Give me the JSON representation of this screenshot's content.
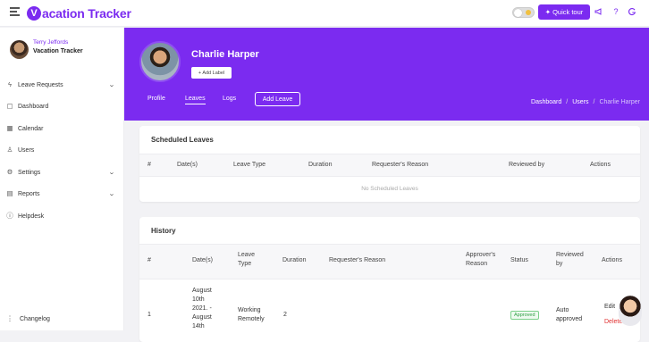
{
  "brand": {
    "logo_letter": "V",
    "name": "acation Tracker",
    "accent": "#7b2bf0"
  },
  "topbar": {
    "quick_tour_label": "✦ Quick tour",
    "icons": [
      "megaphone-icon",
      "help-icon",
      "g-icon"
    ]
  },
  "sidebar": {
    "user_name": "Terry Jeffords",
    "company": "Vacation Tracker",
    "items": [
      {
        "label": "Leave Requests",
        "icon": "lightning-icon",
        "expandable": true
      },
      {
        "label": "Dashboard",
        "icon": "dashboard-icon",
        "expandable": false
      },
      {
        "label": "Calendar",
        "icon": "calendar-icon",
        "expandable": false
      },
      {
        "label": "Users",
        "icon": "user-icon",
        "expandable": false
      },
      {
        "label": "Settings",
        "icon": "gear-icon",
        "expandable": true
      },
      {
        "label": "Reports",
        "icon": "reports-icon",
        "expandable": true
      },
      {
        "label": "Helpdesk",
        "icon": "help-circle-icon",
        "expandable": false
      }
    ],
    "changelog": "Changelog"
  },
  "profile": {
    "name": "Charlie Harper",
    "add_label": "+ Add Label",
    "tabs": [
      "Profile",
      "Leaves",
      "Logs"
    ],
    "active_tab": "Leaves",
    "add_leave": "Add Leave"
  },
  "breadcrumb": [
    "Dashboard",
    "Users",
    "Charlie Harper"
  ],
  "scheduled": {
    "title": "Scheduled Leaves",
    "columns": [
      "#",
      "Date(s)",
      "Leave Type",
      "Duration",
      "Requester's Reason",
      "Reviewed by",
      "Actions"
    ],
    "empty": "No Scheduled Leaves"
  },
  "history": {
    "title": "History",
    "columns": [
      "#",
      "Date(s)",
      "Leave\nType",
      "Duration",
      "Requester's Reason",
      "Approver's\nReason",
      "Status",
      "Reviewed\nby",
      "Actions"
    ],
    "rows": [
      {
        "index": "1",
        "dates": "August\n10th\n2021. -\nAugust\n14th",
        "leave_type": "Working\nRemotely",
        "duration": "2",
        "status": "Approved",
        "reviewed_by": "Auto\napproved",
        "actions": [
          "Edit",
          "Delete"
        ]
      }
    ]
  }
}
